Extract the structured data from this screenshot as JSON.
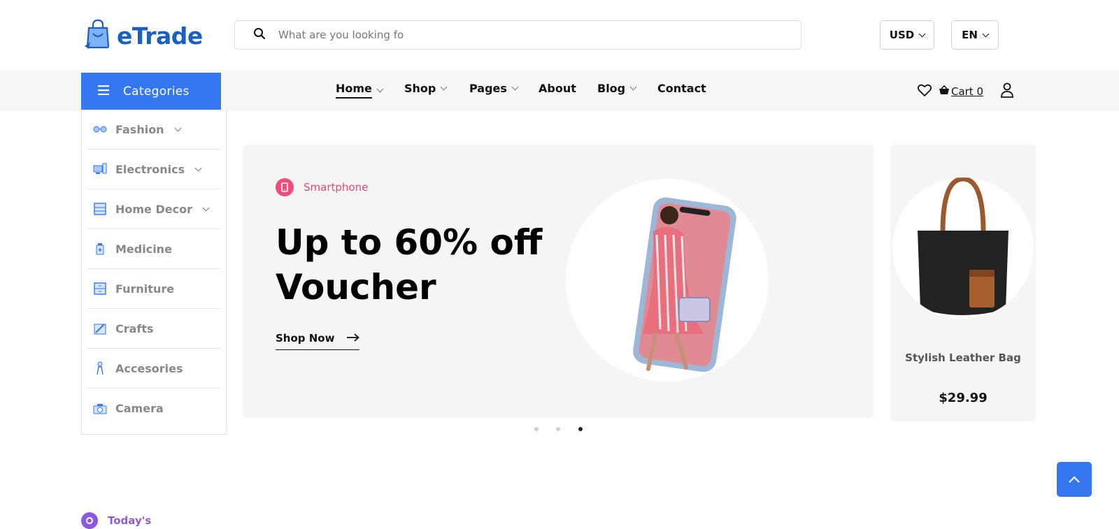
{
  "brand": {
    "name": "eTrade",
    "color": "#1b5fbf"
  },
  "search": {
    "placeholder": "What are you looking fo"
  },
  "currency": {
    "selected": "USD"
  },
  "language": {
    "selected": "EN"
  },
  "categories_button": {
    "label": "Categories",
    "color": "#3577f0"
  },
  "main_nav": [
    {
      "label": "Home",
      "has_dropdown": true,
      "active": true
    },
    {
      "label": "Shop",
      "has_dropdown": true
    },
    {
      "label": "Pages",
      "has_dropdown": true
    },
    {
      "label": "About",
      "has_dropdown": false
    },
    {
      "label": "Blog",
      "has_dropdown": true
    },
    {
      "label": "Contact",
      "has_dropdown": false
    }
  ],
  "header_actions": {
    "cart_label": "Cart 0"
  },
  "sidebar": {
    "items": [
      {
        "label": "Fashion",
        "icon": "glasses-icon",
        "has_dropdown": true
      },
      {
        "label": "Electronics",
        "icon": "computer-icon",
        "has_dropdown": true
      },
      {
        "label": "Home Decor",
        "icon": "cabinet-icon",
        "has_dropdown": true
      },
      {
        "label": "Medicine",
        "icon": "medicine-bottle-icon",
        "has_dropdown": false
      },
      {
        "label": "Furniture",
        "icon": "drawer-icon",
        "has_dropdown": false
      },
      {
        "label": "Crafts",
        "icon": "crafts-icon",
        "has_dropdown": false
      },
      {
        "label": "Accesories",
        "icon": "accessory-icon",
        "has_dropdown": false
      },
      {
        "label": "Camera",
        "icon": "camera-icon",
        "has_dropdown": false
      }
    ]
  },
  "hero": {
    "tag": "Smartphone",
    "headline": "Up to 60% off Voucher",
    "cta": "Shop Now",
    "tag_color": "#e8456f"
  },
  "side_product": {
    "name": "Stylish Leather Bag",
    "price": "$29.99"
  },
  "slider": {
    "dots": 3,
    "active_index": 2
  },
  "section": {
    "label": "Today's",
    "color": "#8c5ae0"
  }
}
